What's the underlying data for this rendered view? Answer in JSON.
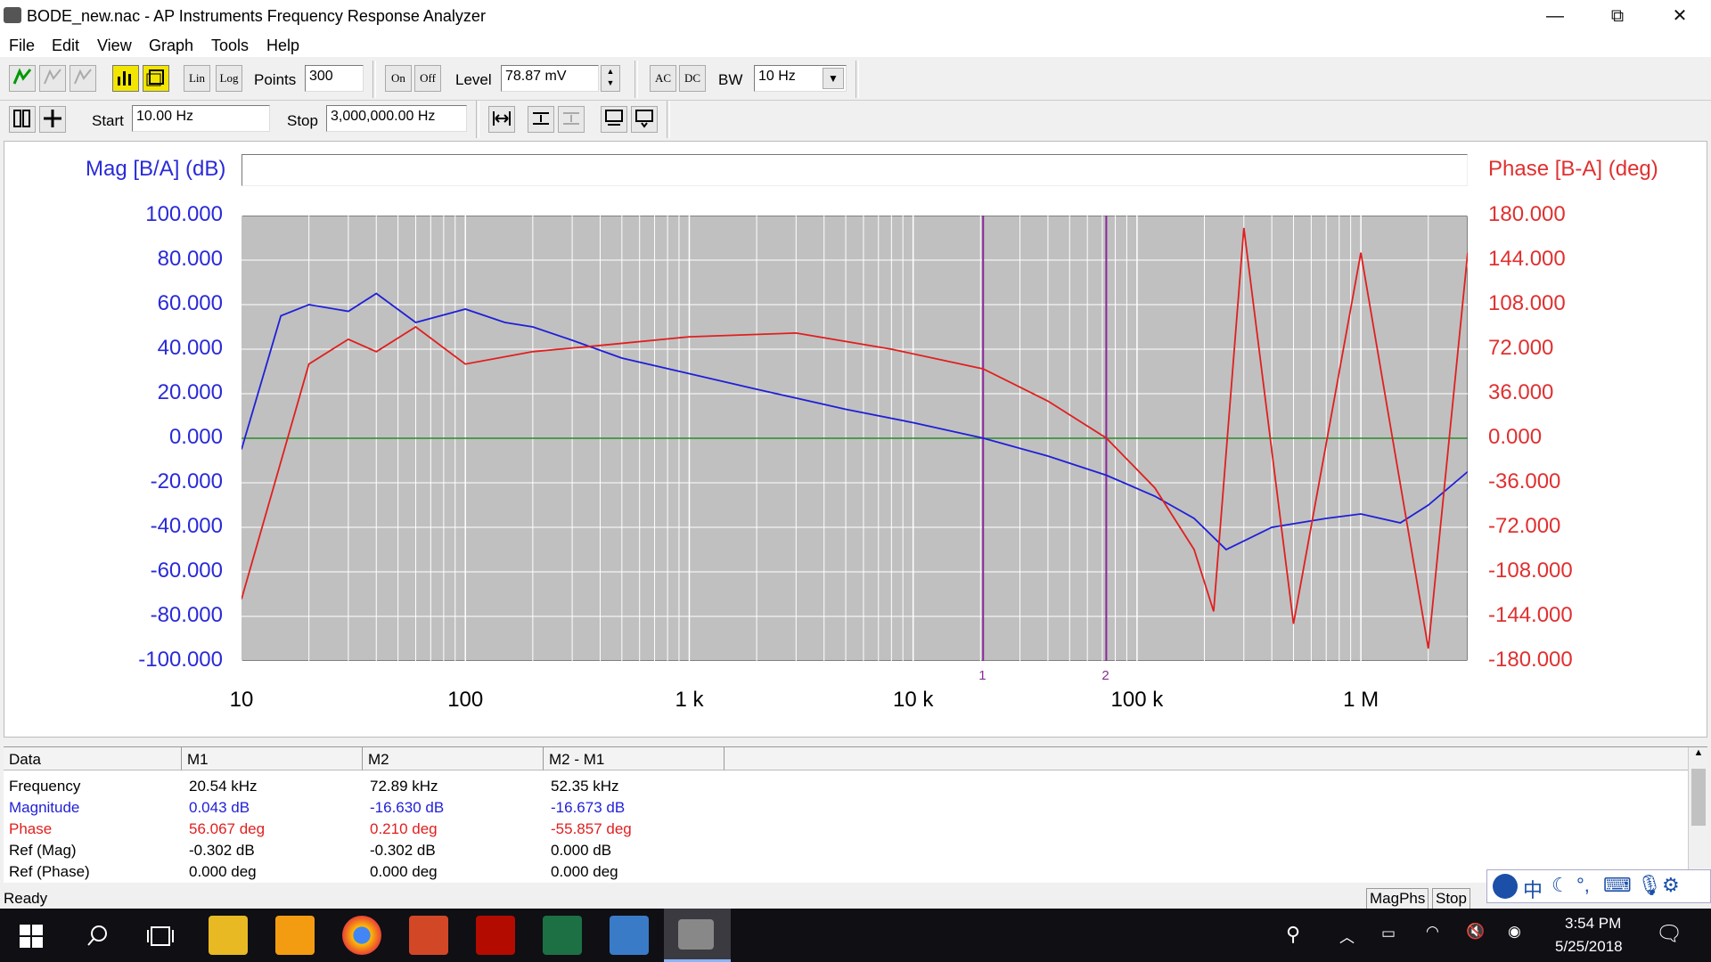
{
  "window": {
    "title": "BODE_new.nac - AP Instruments Frequency Response Analyzer",
    "minimize_glyph": "—",
    "maximize_glyph": "⧉",
    "close_glyph": "✕"
  },
  "menu": [
    "File",
    "Edit",
    "View",
    "Graph",
    "Tools",
    "Help"
  ],
  "toolbar1": {
    "lin_label": "Lin",
    "log_label": "Log",
    "points_label": "Points",
    "points_value": "300",
    "on_label": "On",
    "off_label": "Off",
    "level_label": "Level",
    "level_value": "78.87 mV",
    "ac_label": "AC",
    "dc_label": "DC",
    "bw_label": "BW",
    "bw_value": "10 Hz"
  },
  "toolbar2": {
    "start_label": "Start",
    "start_value": "10.00 Hz",
    "stop_label": "Stop",
    "stop_value": "3,000,000.00 Hz"
  },
  "chart_data": {
    "type": "line",
    "left_axis_label": "Mag [B/A] (dB)",
    "right_axis_label": "Phase [B-A] (deg)",
    "xscale": "log",
    "xlim": [
      10,
      3000000
    ],
    "x_tick_labels": [
      "10",
      "100",
      "1 k",
      "10 k",
      "100 k",
      "1 M"
    ],
    "ylim_left": [
      -100,
      100
    ],
    "ylim_right": [
      -180,
      180
    ],
    "y_left_tick_labels": [
      "100.000",
      "80.000",
      "60.000",
      "40.000",
      "20.000",
      "0.000",
      "-20.000",
      "-40.000",
      "-60.000",
      "-80.000",
      "-100.000"
    ],
    "y_right_tick_labels": [
      "180.000",
      "144.000",
      "108.000",
      "72.000",
      "36.000",
      "0.000",
      "-36.000",
      "-72.000",
      "-108.000",
      "-144.000",
      "-180.000"
    ],
    "grid": true,
    "background": "#c0c0c0",
    "markers": [
      {
        "label": "1",
        "x": 20540
      },
      {
        "label": "2",
        "x": 72890
      }
    ],
    "series": [
      {
        "axis": "left",
        "color": "#1f1fd8",
        "x": [
          10,
          15,
          20,
          30,
          40,
          60,
          100,
          150,
          200,
          300,
          500,
          1000,
          2000,
          5000,
          10000,
          20540,
          40000,
          72890,
          120000,
          180000,
          250000,
          400000,
          700000,
          1000000,
          1500000,
          2000000,
          3000000
        ],
        "y": [
          -5,
          55,
          60,
          57,
          65,
          52,
          58,
          52,
          50,
          44,
          36,
          29,
          22,
          13,
          7,
          0.04,
          -8,
          -16.6,
          -26,
          -36,
          -50,
          -40,
          -36,
          -34,
          -38,
          -30,
          -15
        ]
      },
      {
        "axis": "right",
        "color": "#e01f1f",
        "x": [
          10,
          20,
          30,
          40,
          60,
          100,
          200,
          400,
          1000,
          3000,
          8000,
          20540,
          40000,
          72890,
          120000,
          180000,
          220000,
          300000,
          500000,
          1000000,
          2000000,
          3000000
        ],
        "y": [
          -130,
          60,
          80,
          70,
          90,
          60,
          70,
          75,
          82,
          85,
          72,
          56.07,
          30,
          0.21,
          -40,
          -90,
          -140,
          170,
          -150,
          150,
          -170,
          150
        ]
      }
    ]
  },
  "data_table": {
    "headers": [
      "Data",
      "M1",
      "M2",
      "M2 - M1"
    ],
    "rows": [
      {
        "label": "Frequency",
        "m1": "20.54 kHz",
        "m2": "72.89 kHz",
        "diff": "52.35 kHz",
        "color": "#000000"
      },
      {
        "label": "Magnitude",
        "m1": "0.043 dB",
        "m2": "-16.630 dB",
        "diff": "-16.673 dB",
        "color": "#1f1fd8"
      },
      {
        "label": "Phase",
        "m1": "56.067 deg",
        "m2": "0.210 deg",
        "diff": "-55.857 deg",
        "color": "#e01f1f"
      },
      {
        "label": "Ref (Mag)",
        "m1": "-0.302 dB",
        "m2": "-0.302 dB",
        "diff": "0.000 dB",
        "color": "#000000"
      },
      {
        "label": "Ref (Phase)",
        "m1": "0.000 deg",
        "m2": "0.000 deg",
        "diff": "0.000 deg",
        "color": "#000000"
      }
    ]
  },
  "status": {
    "text": "Ready",
    "magphs_label": "MagPhs",
    "stop_label": "Stop"
  },
  "ime": {
    "chinese_char": "中"
  },
  "taskbar": {
    "time": "3:54 PM",
    "date": "5/25/2018",
    "apps": [
      "start",
      "search",
      "task-view",
      "file-explorer",
      "outlook",
      "chrome",
      "powerpoint",
      "acrobat",
      "excel",
      "photos",
      "fra-app"
    ]
  }
}
